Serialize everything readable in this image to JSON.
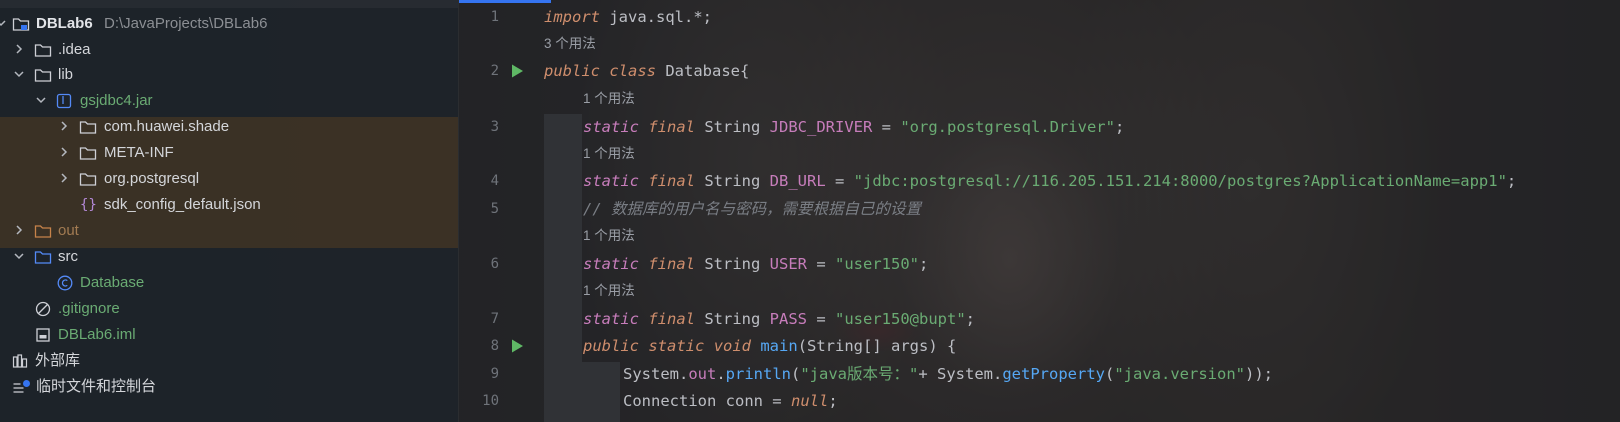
{
  "project": {
    "root_name": "DBLab6",
    "root_path": "D:\\JavaProjects\\DBLab6",
    "items": [
      {
        "label": ".idea"
      },
      {
        "label": "lib"
      },
      {
        "label": "gsjdbc4.jar"
      },
      {
        "label": "com.huawei.shade"
      },
      {
        "label": "META-INF"
      },
      {
        "label": "org.postgresql"
      },
      {
        "label": "sdk_config_default.json"
      },
      {
        "label": "out"
      },
      {
        "label": "src"
      },
      {
        "label": "Database"
      },
      {
        "label": ".gitignore"
      },
      {
        "label": "DBLab6.iml"
      },
      {
        "label": "外部库"
      },
      {
        "label": "临时文件和控制台"
      }
    ]
  },
  "editor": {
    "line_numbers": [
      "1",
      "2",
      "3",
      "4",
      "5",
      "6",
      "7",
      "8",
      "9",
      "10"
    ],
    "usage_hints": [
      "3 个用法",
      "1 个用法",
      "1 个用法",
      "1 个用法",
      "1 个用法"
    ],
    "code": {
      "l1": {
        "kw": "import",
        "rest": " java.sql.*;"
      },
      "l2": {
        "kw1": "public",
        "kw2": "class",
        "name": " Database{"
      },
      "l3": {
        "kw1": "static",
        "kw2": "final",
        "type": " String ",
        "field": "JDBC_DRIVER",
        "eq": " = ",
        "str": "\"org.postgresql.Driver\"",
        "end": ";"
      },
      "l4": {
        "kw1": "static",
        "kw2": "final",
        "type": " String ",
        "field": "DB_URL",
        "eq": " = ",
        "str": "\"jdbc:postgresql://116.205.151.214:8000/postgres?ApplicationName=app1\"",
        "end": ";"
      },
      "l5": {
        "comment": "// 数据库的用户名与密码，需要根据自己的设置"
      },
      "l6": {
        "kw1": "static",
        "kw2": "final",
        "type": " String ",
        "field": "USER",
        "eq": " = ",
        "str": "\"user150\"",
        "end": ";"
      },
      "l7": {
        "kw1": "static",
        "kw2": "final",
        "type": " String ",
        "field": "PASS",
        "eq": " = ",
        "str": "\"user150@bupt\"",
        "end": ";"
      },
      "l8": {
        "kw1": "public",
        "kw2": "static",
        "kw3": "void",
        "method": " main",
        "args": "(String[] args) {"
      },
      "l9": {
        "a": "System.",
        "b": "out",
        "c": ".",
        "d": "println",
        "e": "(",
        "s1": "\"java版本号：\"",
        "f": "+ System.",
        "g": "getProperty",
        "h": "(",
        "s2": "\"java.version\"",
        "i": "));"
      },
      "l10": {
        "a": "Connection conn = ",
        "nul": "null",
        "b": ";"
      }
    }
  },
  "colors": {
    "keyword": "#cf8e6d",
    "string": "#6aab73",
    "field": "#c77dbb",
    "method": "#56a8f5",
    "accent": "#3574f0"
  }
}
